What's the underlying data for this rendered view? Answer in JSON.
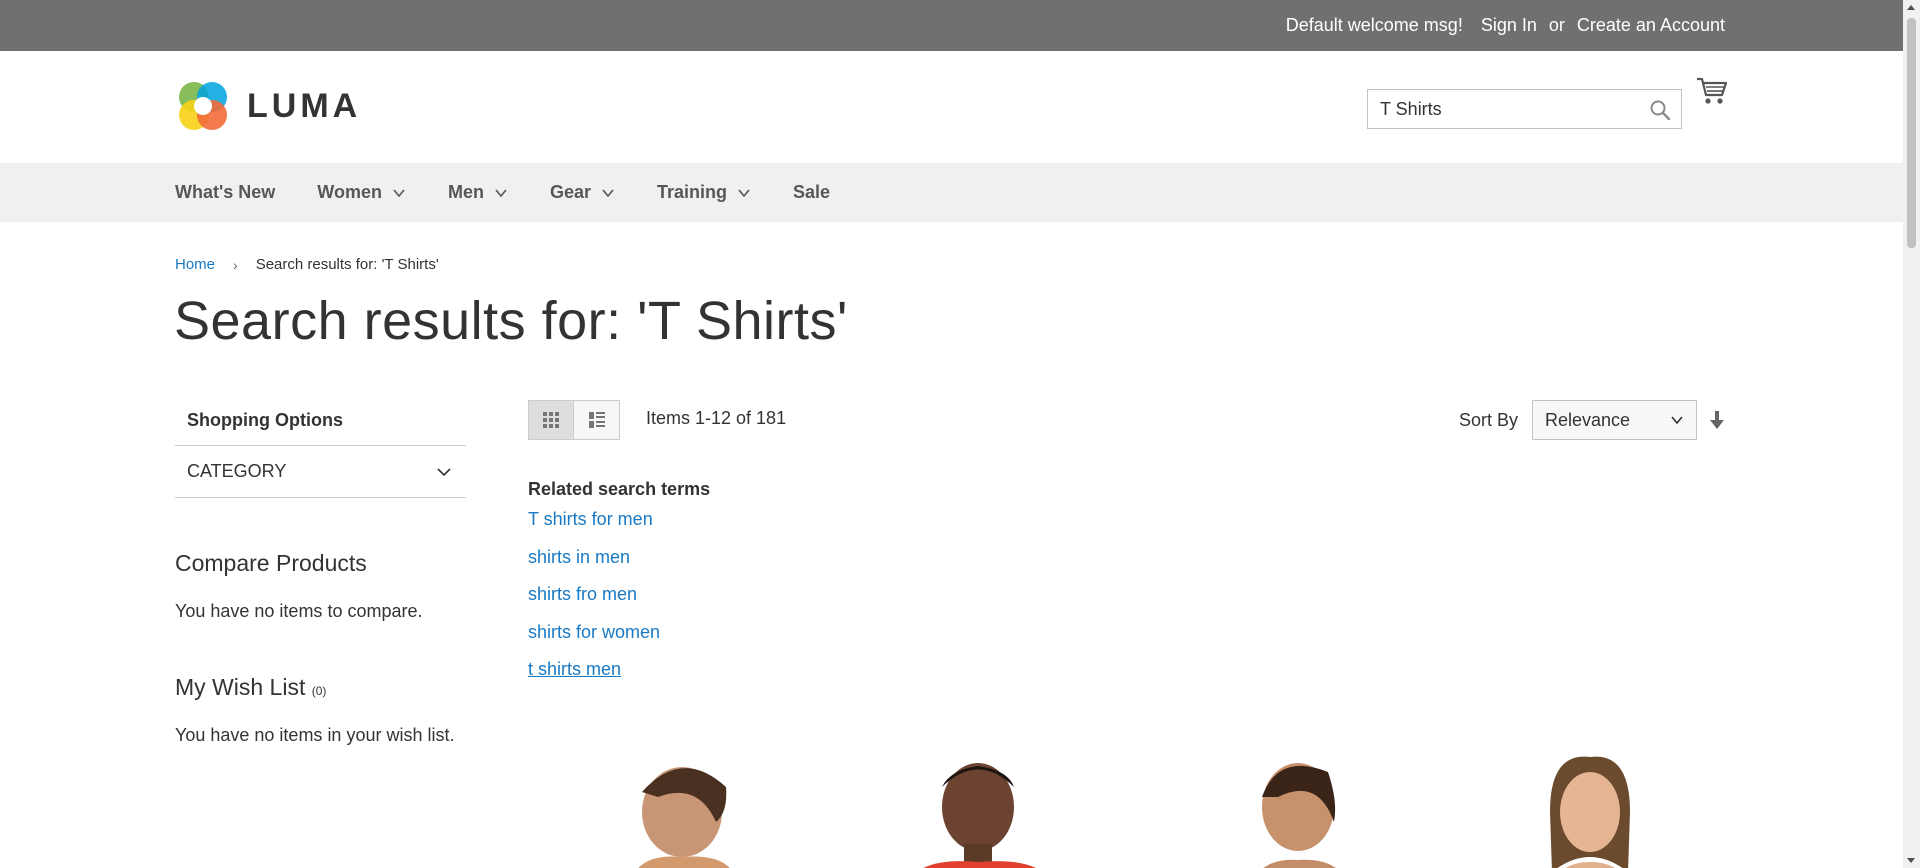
{
  "panel": {
    "welcome": "Default welcome msg!",
    "sign_in": "Sign In",
    "or": "or",
    "create_account": "Create an Account"
  },
  "header": {
    "logo_text": "LUMA",
    "search_value": "T Shirts"
  },
  "nav": {
    "items": [
      {
        "label": "What's New",
        "dropdown": false
      },
      {
        "label": "Women",
        "dropdown": true
      },
      {
        "label": "Men",
        "dropdown": true
      },
      {
        "label": "Gear",
        "dropdown": true
      },
      {
        "label": "Training",
        "dropdown": true
      },
      {
        "label": "Sale",
        "dropdown": false
      }
    ]
  },
  "breadcrumbs": {
    "home": "Home",
    "current": "Search results for: 'T Shirts'"
  },
  "page_title": "Search results for: 'T Shirts'",
  "sidebar": {
    "shopping_options": "Shopping Options",
    "category": "CATEGORY",
    "compare_title": "Compare Products",
    "compare_text": "You have no items to compare.",
    "wishlist_title": "My Wish List",
    "wishlist_count": "0",
    "wishlist_text": "You have no items in your wish list."
  },
  "toolbar": {
    "amount": "Items 1-12 of 181",
    "sort_label": "Sort By",
    "sort_value": "Relevance"
  },
  "related": {
    "title": "Related search terms",
    "terms": [
      "T shirts for men",
      "shirts in men",
      "shirts fro men",
      "shirts for women",
      "t shirts men"
    ]
  },
  "colors": {
    "panel_bg": "#6e716e",
    "link": "#1979c3",
    "nav_bg": "#f0f0f0"
  }
}
